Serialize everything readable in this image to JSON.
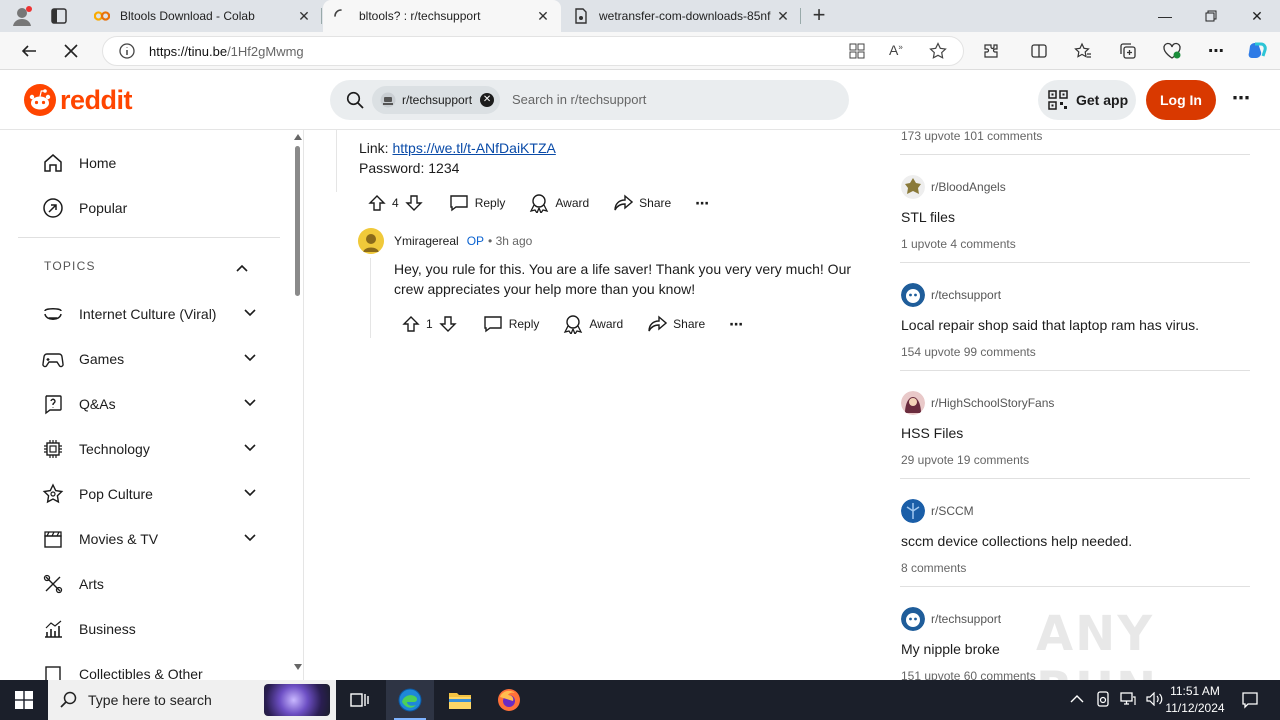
{
  "browser": {
    "tabs": [
      {
        "title": "Bltools Download - Colab",
        "icon": "colab-icon",
        "active": false
      },
      {
        "title": "bltools? : r/techsupport",
        "icon": "loading-icon",
        "active": true
      },
      {
        "title": "wetransfer-com-downloads-85nf",
        "icon": "document-icon",
        "active": false
      }
    ],
    "url_host": "https://tinu.be",
    "url_path": "/1Hf2gMwmg"
  },
  "reddit": {
    "logo_text": "reddit",
    "search_chip": "r/techsupport",
    "search_placeholder": "Search in r/techsupport",
    "get_app": "Get app",
    "login": "Log In"
  },
  "sidebar": {
    "home": "Home",
    "popular": "Popular",
    "topics_heading": "TOPICS",
    "topics": [
      {
        "label": "Internet Culture (Viral)",
        "icon": "smile-icon"
      },
      {
        "label": "Games",
        "icon": "gamepad-icon"
      },
      {
        "label": "Q&As",
        "icon": "question-icon"
      },
      {
        "label": "Technology",
        "icon": "chip-icon"
      },
      {
        "label": "Pop Culture",
        "icon": "star-icon"
      },
      {
        "label": "Movies & TV",
        "icon": "clapper-icon"
      },
      {
        "label": "Arts",
        "icon": "arts-icon"
      },
      {
        "label": "Business",
        "icon": "chart-icon"
      },
      {
        "label": "Collectibles & Other",
        "icon": "collectibles-icon"
      }
    ]
  },
  "comment1": {
    "link_prefix": "Link: ",
    "link": "https://we.tl/t-ANfDaiKTZA",
    "password": "Password: 1234",
    "votes": "4",
    "reply": "Reply",
    "award": "Award",
    "share": "Share"
  },
  "comment2": {
    "author": "Ymiragereal",
    "op": "OP",
    "time": "• 3h ago",
    "text_line1": "Hey, you rule for this. You are a life saver! Thank you very very much! Our",
    "text_line2": "crew appreciates your help more than you know!",
    "votes": "1",
    "reply": "Reply",
    "award": "Award",
    "share": "Share"
  },
  "rail": {
    "top_stats": "173 upvote  101 comments",
    "posts": [
      {
        "sub": "r/BloodAngels",
        "title": "STL files",
        "stats": "1 upvote  4 comments",
        "color": "#b8a96a"
      },
      {
        "sub": "r/techsupport",
        "title": "Local repair shop said that laptop ram has virus.",
        "stats": "154 upvote  99 comments",
        "color": "#2e6bb0"
      },
      {
        "sub": "r/HighSchoolStoryFans",
        "title": "HSS Files",
        "stats": "29 upvote  19 comments",
        "color": "#8b3a62"
      },
      {
        "sub": "r/SCCM",
        "title": "sccm device collections help needed.",
        "stats": "8 comments",
        "color": "#1a5ea8"
      },
      {
        "sub": "r/techsupport",
        "title": "My nipple broke",
        "stats": "151 upvote  60 comments",
        "color": "#2e6bb0"
      }
    ]
  },
  "watermark": "ANY RUN",
  "taskbar": {
    "search_placeholder": "Type here to search",
    "time": "11:51 AM",
    "date": "11/12/2024"
  }
}
